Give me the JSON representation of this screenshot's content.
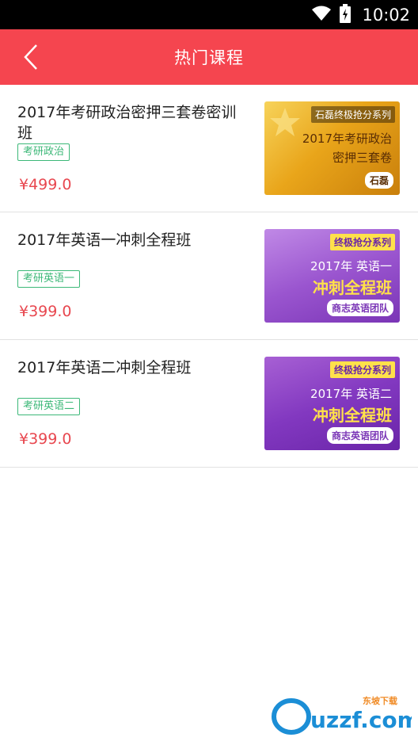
{
  "status_bar": {
    "time": "10:02"
  },
  "header": {
    "title": "热门课程"
  },
  "courses": [
    {
      "title": "2017年考研政治密押三套卷密训班",
      "tag": "考研政治",
      "price": "¥499.0",
      "thumb": {
        "top": "石磊终极抢分系列",
        "line1": "2017年考研政治",
        "line2": "密押三套卷",
        "badge": "石磊"
      }
    },
    {
      "title": "2017年英语一冲刺全程班",
      "tag": "考研英语一",
      "price": "¥399.0",
      "thumb": {
        "top": "终极抢分系列",
        "line1": "2017年 英语一",
        "line2": "冲刺全程班",
        "badge": "商志英语团队"
      }
    },
    {
      "title": "2017年英语二冲刺全程班",
      "tag": "考研英语二",
      "price": "¥399.0",
      "thumb": {
        "top": "终极抢分系列",
        "line1": "2017年 英语二",
        "line2": "冲刺全程班",
        "badge": "商志英语团队"
      }
    }
  ],
  "watermark": {
    "text": "uzzf.com",
    "sub": "东坡下载"
  },
  "colors": {
    "header": "#f5454f",
    "price": "#e8474f",
    "tag": "#3cb878"
  }
}
